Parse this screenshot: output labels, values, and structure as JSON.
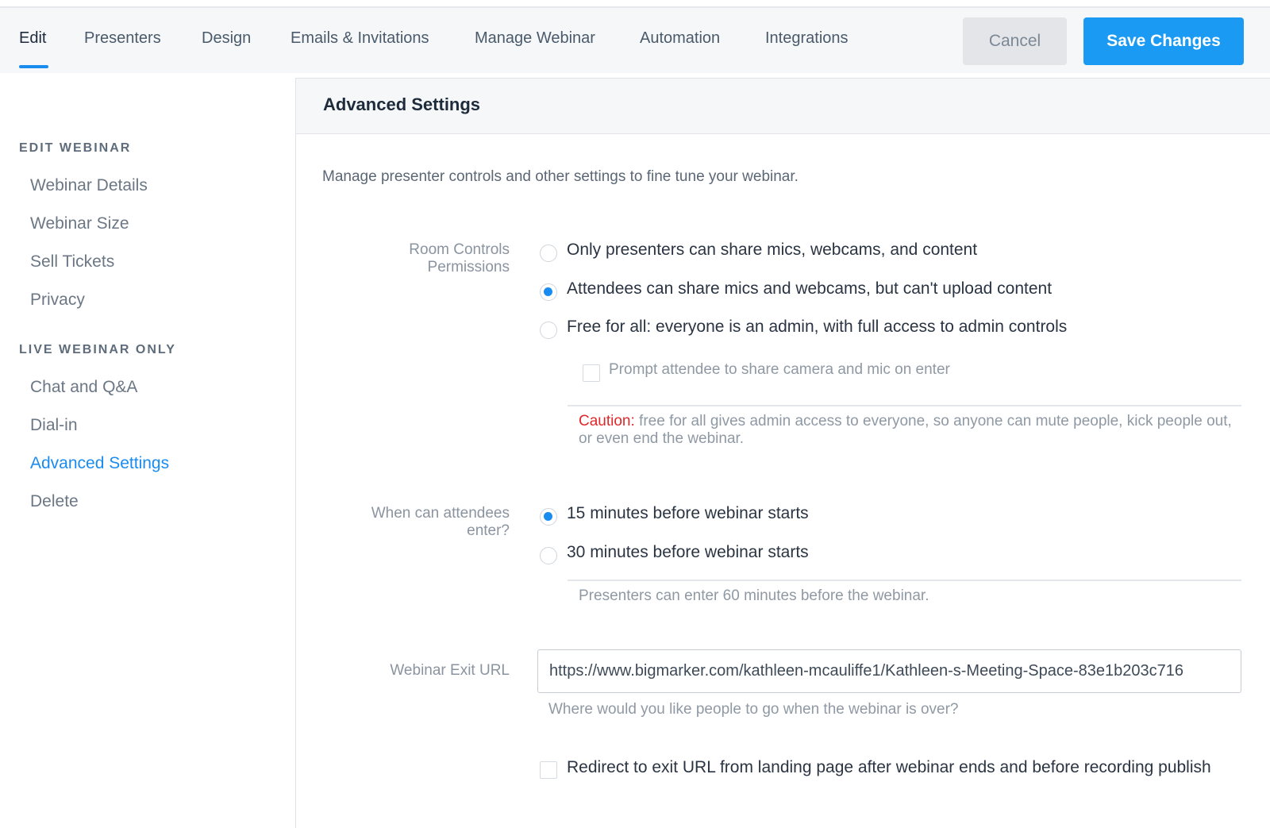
{
  "nav": {
    "tabs": [
      {
        "label": "Edit",
        "active": true
      },
      {
        "label": "Presenters"
      },
      {
        "label": "Design"
      },
      {
        "label": "Emails & Invitations"
      },
      {
        "label": "Manage Webinar"
      },
      {
        "label": "Automation"
      },
      {
        "label": "Integrations"
      }
    ],
    "cancel_label": "Cancel",
    "save_label": "Save Changes"
  },
  "sidebar": {
    "section1_heading": "EDIT WEBINAR",
    "section1_items": [
      "Webinar Details",
      "Webinar Size",
      "Sell Tickets",
      "Privacy"
    ],
    "section2_heading": "LIVE WEBINAR ONLY",
    "section2_items": [
      "Chat and Q&A",
      "Dial-in",
      "Advanced Settings",
      "Delete"
    ],
    "active_item": "Advanced Settings"
  },
  "panel": {
    "title": "Advanced Settings",
    "intro": "Manage presenter controls and other settings to fine tune your webinar.",
    "room_controls": {
      "label_line1": "Room Controls",
      "label_line2": "Permissions",
      "options": [
        {
          "label": "Only presenters can share mics, webcams, and content",
          "checked": false
        },
        {
          "label": "Attendees can share mics and webcams, but can't upload content",
          "checked": true
        },
        {
          "label": "Free for all: everyone is an admin, with full access to admin controls",
          "checked": false
        }
      ],
      "prompt_checkbox_label": "Prompt attendee to share camera and mic on enter",
      "prompt_checked": false,
      "caution_label": "Caution:",
      "caution_text": " free for all gives admin access to everyone, so anyone can mute people, kick people out, or even end the webinar."
    },
    "entry_time": {
      "label_line1": "When can attendees",
      "label_line2": "enter?",
      "options": [
        {
          "label": "15 minutes before webinar starts",
          "checked": true
        },
        {
          "label": "30 minutes before webinar starts",
          "checked": false
        }
      ],
      "note": "Presenters can enter 60 minutes before the webinar."
    },
    "exit_url": {
      "label": "Webinar Exit URL",
      "value": "https://www.bigmarker.com/kathleen-mcauliffe1/Kathleen-s-Meeting-Space-83e1b203c716",
      "help": "Where would you like people to go when the webinar is over?"
    },
    "redirect": {
      "label": "Redirect to exit URL from landing page after webinar ends and before recording publish",
      "checked": false
    }
  },
  "colors": {
    "accent": "#1a8cf0",
    "save_button": "#1a9af2",
    "caution": "#e0282a"
  }
}
